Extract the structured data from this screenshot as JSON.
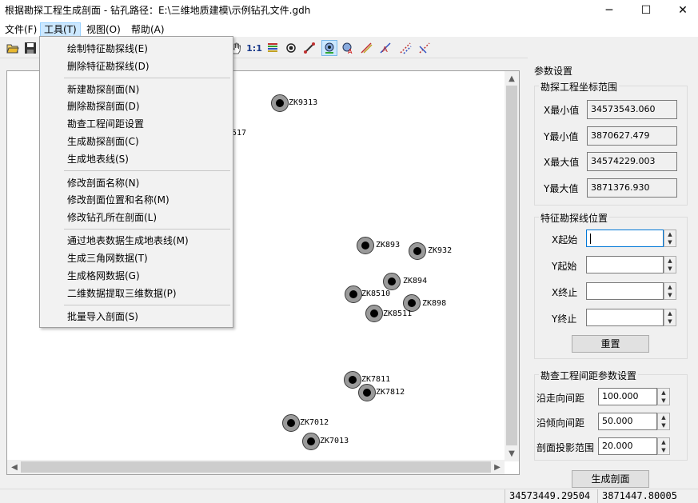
{
  "window": {
    "title": "根据勘探工程生成剖面 - 钻孔路径：E:\\三维地质建模\\示例钻孔文件.gdh",
    "minimize": "─",
    "maximize": "☐",
    "close": "✕"
  },
  "menubar": {
    "file": "文件(F)",
    "tools": "工具(T)",
    "view": "视图(O)",
    "help": "帮助(A)"
  },
  "toolbar": {
    "scale_label": "1:1",
    "icons": [
      "open-icon",
      "save-icon",
      "hand-icon",
      "scale-1to1-icon",
      "legend-icon",
      "point-icon",
      "line-tool-icon",
      "drillhole-icon",
      "label-icon",
      "edit-line-icon",
      "text-line-icon",
      "dashed-line-icon",
      "cross-line-icon"
    ]
  },
  "tools_menu": {
    "items": [
      "绘制特征勘探线(E)",
      "删除特征勘探线(D)",
      "新建勘探剖面(N)",
      "删除勘探剖面(D)",
      "勘查工程间距设置",
      "生成勘探剖面(C)",
      "生成地表线(S)",
      "修改剖面名称(N)",
      "修改剖面位置和名称(M)",
      "修改钻孔所在剖面(L)",
      "通过地表数据生成地表线(M)",
      "生成三角网数据(T)",
      "生成格网数据(G)",
      "二维数据提取三维数据(P)",
      "批量导入剖面(S)"
    ]
  },
  "canvas": {
    "partial_label": "517",
    "drillholes": [
      "ZK9313",
      "ZK893",
      "ZK932",
      "ZK894",
      "ZK8510",
      "ZK898",
      "ZK8511",
      "ZK7811",
      "ZK7812",
      "ZK7012",
      "ZK7013"
    ]
  },
  "panel": {
    "title": "参数设置",
    "range_group": "勘探工程坐标范围",
    "xmin_label": "X最小值",
    "xmin": "34573543.060",
    "ymin_label": "Y最小值",
    "ymin": "3870627.479",
    "xmax_label": "X最大值",
    "xmax": "34574229.003",
    "ymax_label": "Y最大值",
    "ymax": "3871376.930",
    "line_group": "特征勘探线位置",
    "xstart_label": "X起始",
    "ystart_label": "Y起始",
    "xend_label": "X终止",
    "yend_label": "Y终止",
    "reset": "重置",
    "spacing_group": "勘查工程间距参数设置",
    "strike_label": "沿走向间距",
    "strike": "100.000",
    "dip_label": "沿倾向间距",
    "dip": "50.000",
    "proj_label": "剖面投影范围",
    "proj": "20.000",
    "generate": "生成剖面"
  },
  "status": {
    "x": "34573449.29504",
    "y": "3871447.80005"
  }
}
